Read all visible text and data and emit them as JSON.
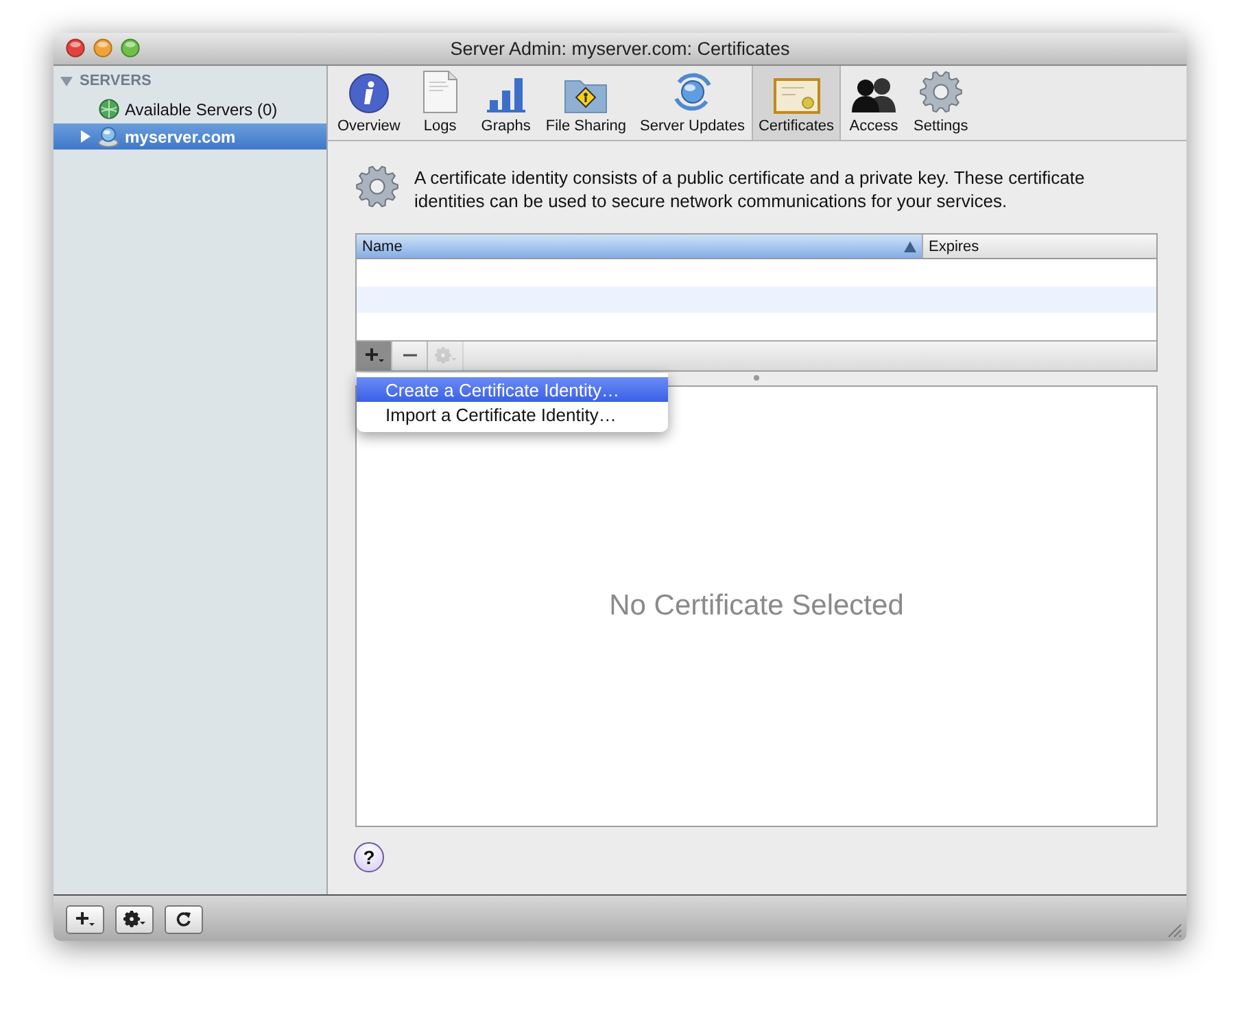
{
  "window": {
    "title": "Server Admin: myserver.com: Certificates"
  },
  "sidebar": {
    "header": {
      "label": "SERVERS",
      "expanded": true
    },
    "items": [
      {
        "label": "Available Servers (0)",
        "kind": "group",
        "selected": false
      },
      {
        "label": "myserver.com",
        "kind": "server",
        "selected": true,
        "expanded": false
      }
    ]
  },
  "toolbar": {
    "tabs": [
      {
        "label": "Overview",
        "kind": "info",
        "selected": false
      },
      {
        "label": "Logs",
        "kind": "document",
        "selected": false
      },
      {
        "label": "Graphs",
        "kind": "bars",
        "selected": false
      },
      {
        "label": "File Sharing",
        "kind": "folder",
        "selected": false
      },
      {
        "label": "Server Updates",
        "kind": "sync",
        "selected": false
      },
      {
        "label": "Certificates",
        "kind": "certificate",
        "selected": true
      },
      {
        "label": "Access",
        "kind": "people",
        "selected": false
      },
      {
        "label": "Settings",
        "kind": "gear",
        "selected": false
      }
    ]
  },
  "description": "A certificate identity consists of a public certificate and a private key. These certificate identities can be used to secure network communications for your services.",
  "table": {
    "columns": [
      {
        "label": "Name",
        "sorted": true
      },
      {
        "label": "Expires",
        "sorted": false
      }
    ],
    "buttons": [
      {
        "kind": "add",
        "pressed": true,
        "disabled": false
      },
      {
        "kind": "remove",
        "pressed": false,
        "disabled": false
      },
      {
        "kind": "action",
        "pressed": false,
        "disabled": true
      }
    ]
  },
  "menu": {
    "items": [
      {
        "label": "Create a Certificate Identity…",
        "selected": true
      },
      {
        "label": "Import a Certificate Identity…",
        "selected": false
      }
    ]
  },
  "detail": {
    "placeholder": "No Certificate Selected"
  },
  "help_button": {
    "label": "?"
  },
  "bottom_bar": {
    "buttons": [
      {
        "kind": "add"
      },
      {
        "kind": "action"
      },
      {
        "kind": "refresh"
      }
    ]
  }
}
